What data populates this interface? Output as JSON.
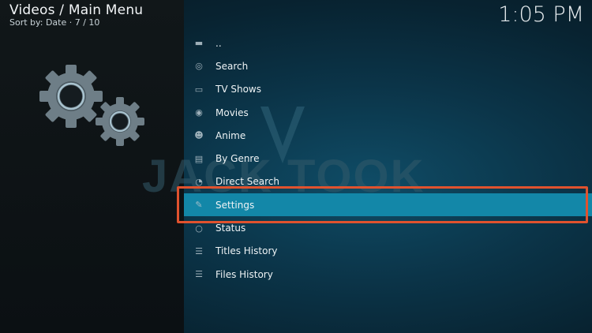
{
  "header": {
    "title": "Videos / Main Menu",
    "subtitle": "Sort by: Date  ·  7 / 10",
    "clock": "1:05 PM"
  },
  "watermark": {
    "text": "JACK TOOK"
  },
  "menu": {
    "items": [
      {
        "label": "..",
        "icon": "folder-up-icon",
        "selected": false
      },
      {
        "label": "Search",
        "icon": "search-icon",
        "selected": false
      },
      {
        "label": "TV Shows",
        "icon": "tv-icon",
        "selected": false
      },
      {
        "label": "Movies",
        "icon": "film-camera-icon",
        "selected": false
      },
      {
        "label": "Anime",
        "icon": "anime-icon",
        "selected": false
      },
      {
        "label": "By Genre",
        "icon": "genre-icon",
        "selected": false
      },
      {
        "label": "Direct Search",
        "icon": "direct-search-icon",
        "selected": false
      },
      {
        "label": "Settings",
        "icon": "wrench-icon",
        "selected": true
      },
      {
        "label": "Status",
        "icon": "status-icon",
        "selected": false
      },
      {
        "label": "Titles History",
        "icon": "list-icon",
        "selected": false
      },
      {
        "label": "Files History",
        "icon": "list-icon",
        "selected": false
      }
    ]
  },
  "colors": {
    "selection": "#1387a8",
    "highlight_border": "#e0522e",
    "background": "#0b3448"
  }
}
